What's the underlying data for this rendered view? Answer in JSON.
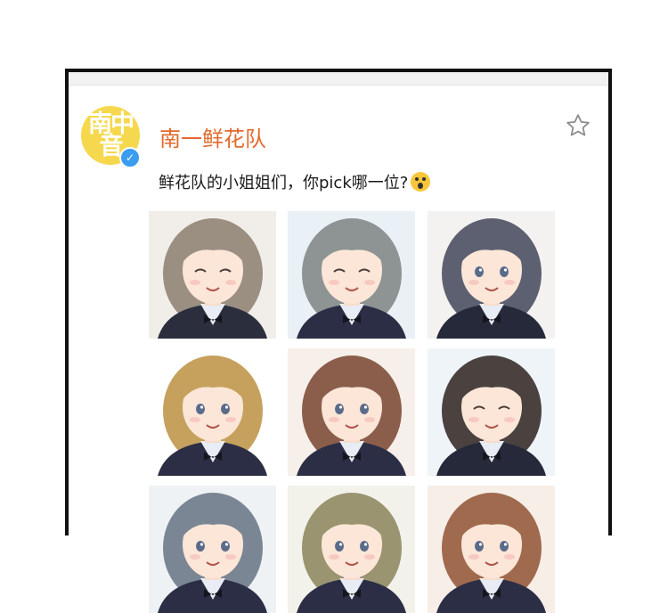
{
  "post": {
    "username": "南一鲜花队",
    "avatar_text": "南中音",
    "text": "鲜花队的小姐姐们，你pick哪一位?",
    "emoji": "astonished-face-icon",
    "verified_icon": "check-icon",
    "favorite_icon": "star-outline-icon"
  },
  "colors": {
    "username": "#e26a2c",
    "avatar_bg": "#f6d84e",
    "verified": "#3b9cf0"
  },
  "photos": [
    {
      "hair": "#9b8f82",
      "bg": "#f1eeea",
      "suit": "#2b2f3d",
      "eyes": "closed"
    },
    {
      "hair": "#8d9493",
      "bg": "#e9f0f6",
      "suit": "#2c2e45",
      "eyes": "closed"
    },
    {
      "hair": "#5d6070",
      "bg": "#f4f2f0",
      "suit": "#25293a",
      "eyes": "open"
    },
    {
      "hair": "#c6a15e",
      "bg": "#ffffff",
      "suit": "#2c2e45",
      "eyes": "open"
    },
    {
      "hair": "#8b5e4b",
      "bg": "#f7efe9",
      "suit": "#2c2e45",
      "eyes": "open"
    },
    {
      "hair": "#4b423f",
      "bg": "#eef4f8",
      "suit": "#25293a",
      "eyes": "closed"
    },
    {
      "hair": "#7b8694",
      "bg": "#eef2f5",
      "suit": "#2c2e45",
      "eyes": "open"
    },
    {
      "hair": "#9a9470",
      "bg": "#f2f1ea",
      "suit": "#2c2e45",
      "eyes": "open"
    },
    {
      "hair": "#a06a4e",
      "bg": "#f7eee7",
      "suit": "#2c2e45",
      "eyes": "open"
    }
  ]
}
